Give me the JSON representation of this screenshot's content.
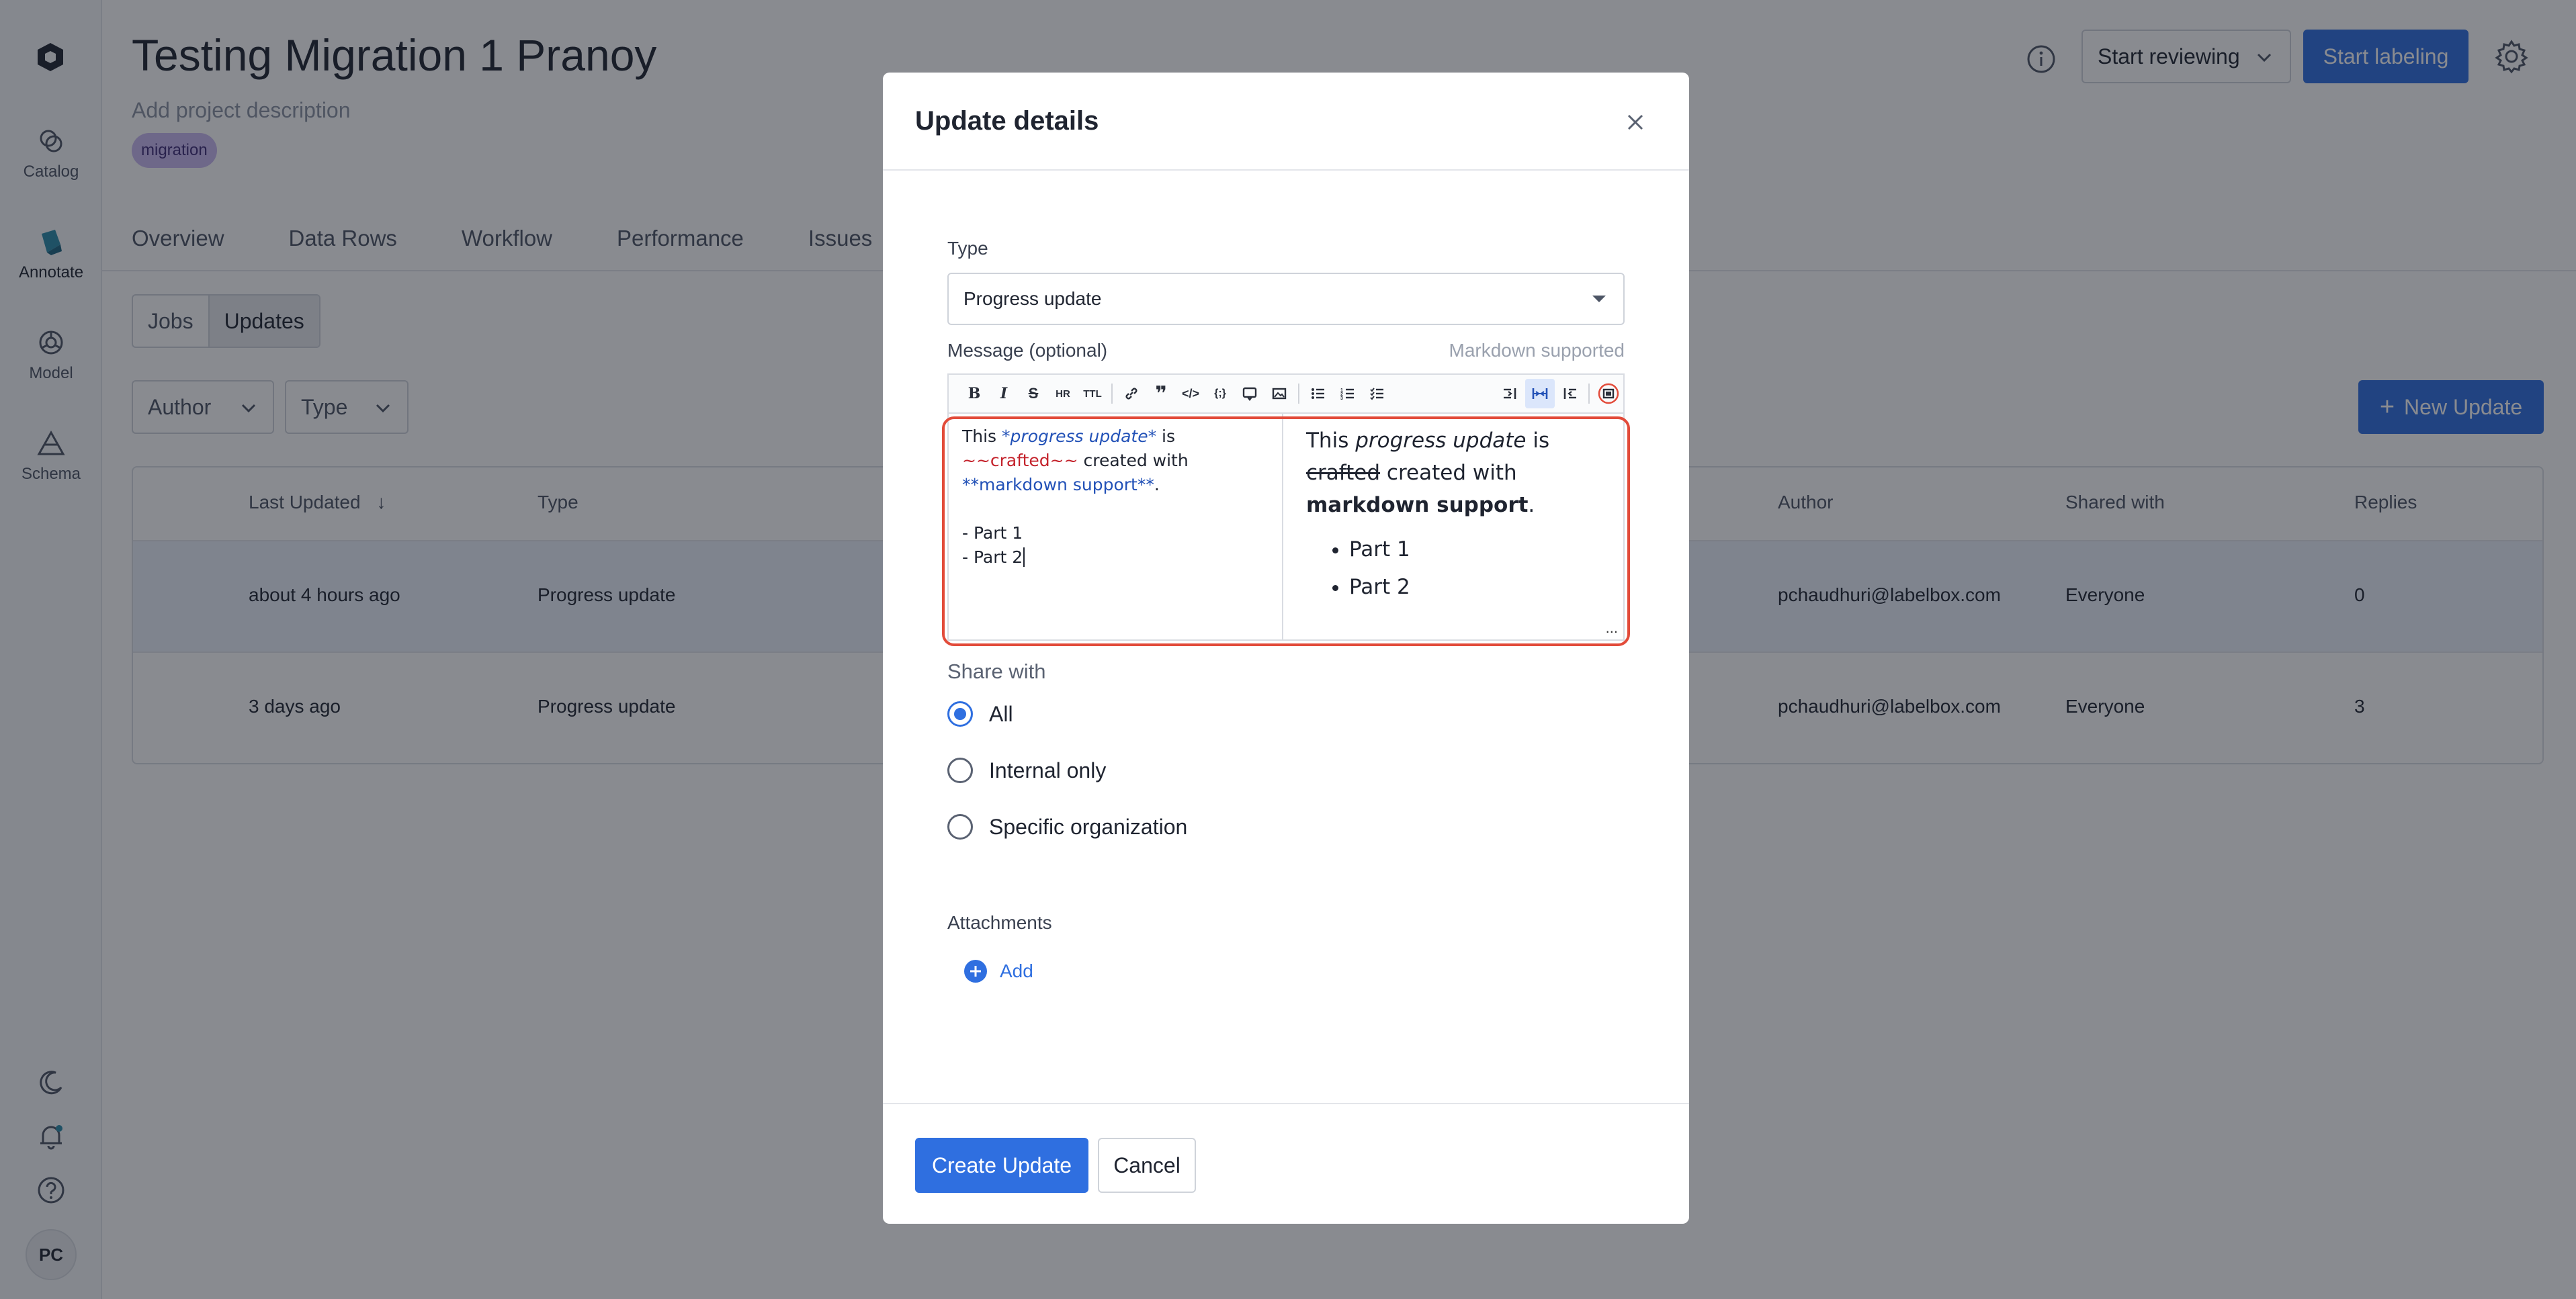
{
  "nav": {
    "items": [
      {
        "label": "Catalog",
        "icon": "catalog-icon"
      },
      {
        "label": "Annotate",
        "icon": "annotate-icon"
      },
      {
        "label": "Model",
        "icon": "model-icon"
      },
      {
        "label": "Schema",
        "icon": "schema-icon"
      }
    ],
    "bottom_icons": [
      "moon-icon",
      "bell-icon",
      "help-icon"
    ],
    "avatar": "PC"
  },
  "header": {
    "title": "Testing Migration 1 Pranoy",
    "description_placeholder": "Add project description",
    "tag": "migration",
    "review_button": "Start reviewing",
    "label_button": "Start labeling"
  },
  "tabs": [
    "Overview",
    "Data Rows",
    "Workflow",
    "Performance",
    "Issues"
  ],
  "segments": {
    "jobs": "Jobs",
    "updates": "Updates"
  },
  "filters": {
    "author": "Author",
    "type": "Type"
  },
  "new_update_button": "New Update",
  "table": {
    "headers": {
      "last_updated": "Last Updated",
      "type": "Type",
      "author": "Author",
      "shared_with": "Shared with",
      "replies": "Replies"
    },
    "rows": [
      {
        "last_updated": "about 4 hours ago",
        "type": "Progress update",
        "author": "pchaudhuri@labelbox.com",
        "shared_with": "Everyone",
        "replies": "0"
      },
      {
        "last_updated": "3 days ago",
        "type": "Progress update",
        "author": "pchaudhuri@labelbox.com",
        "shared_with": "Everyone",
        "replies": "3"
      }
    ]
  },
  "modal": {
    "title": "Update details",
    "type_label": "Type",
    "type_value": "Progress update",
    "message_label": "Message (optional)",
    "markdown_note": "Markdown supported",
    "editor": {
      "src_w1": "This ",
      "src_em": "*progress update*",
      "src_w2": " is",
      "src_del": "~~crafted~~",
      "src_w3": " created with",
      "src_strong": "**markdown support**",
      "src_w4": ".",
      "src_li1": "- Part 1",
      "src_li2": "- Part 2",
      "prev_w1": "This ",
      "prev_em": "progress update",
      "prev_w2": " is",
      "prev_del": "crafted",
      "prev_w3": " created with",
      "prev_strong": "markdown support",
      "prev_w4": ".",
      "prev_items": [
        "Part 1",
        "Part 2"
      ],
      "more": "..."
    },
    "share_label": "Share with",
    "share_options": [
      "All",
      "Internal only",
      "Specific organization"
    ],
    "attachments_label": "Attachments",
    "add_label": "Add",
    "create_button": "Create Update",
    "cancel_button": "Cancel"
  },
  "colors": {
    "primary": "#2f6fe0",
    "tag_bg": "#c9b8f0",
    "editor_outline": "#e24b3a"
  }
}
